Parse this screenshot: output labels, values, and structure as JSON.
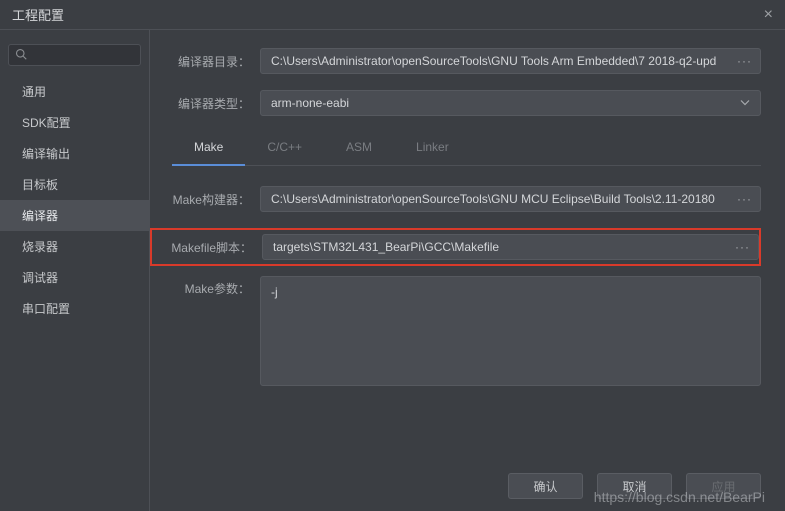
{
  "titlebar": {
    "title": "工程配置"
  },
  "sidebar": {
    "items": [
      {
        "label": "通用"
      },
      {
        "label": "SDK配置"
      },
      {
        "label": "编译输出"
      },
      {
        "label": "目标板"
      },
      {
        "label": "编译器"
      },
      {
        "label": "烧录器"
      },
      {
        "label": "调试器"
      },
      {
        "label": "串口配置"
      }
    ],
    "active_index": 4
  },
  "form": {
    "compiler_dir_label": "编译器目录：",
    "compiler_dir_value": "C:\\Users\\Administrator\\openSourceTools\\GNU Tools Arm Embedded\\7 2018-q2-upd",
    "compiler_type_label": "编译器类型：",
    "compiler_type_value": "arm-none-eabi",
    "make_builder_label": "Make构建器：",
    "make_builder_value": "C:\\Users\\Administrator\\openSourceTools\\GNU MCU Eclipse\\Build Tools\\2.11-20180",
    "makefile_script_label": "Makefile脚本：",
    "makefile_script_value": "targets\\STM32L431_BearPi\\GCC\\Makefile",
    "make_params_label": "Make参数：",
    "make_params_value": "-j"
  },
  "tabs": {
    "items": [
      {
        "label": "Make"
      },
      {
        "label": "C/C++"
      },
      {
        "label": "ASM"
      },
      {
        "label": "Linker"
      }
    ],
    "active_index": 0
  },
  "buttons": {
    "ok": "确认",
    "cancel": "取消",
    "apply": "应用"
  },
  "watermark": "https://blog.csdn.net/BearPi"
}
